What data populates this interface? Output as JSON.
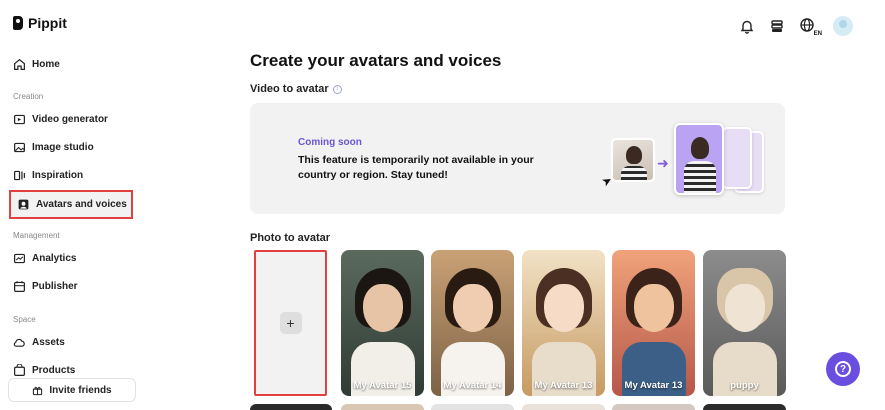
{
  "app": {
    "name": "Pippit"
  },
  "nav": {
    "home": "Home",
    "section_creation": "Creation",
    "video_generator": "Video generator",
    "image_studio": "Image studio",
    "inspiration": "Inspiration",
    "avatars_and_voices": "Avatars and voices",
    "section_management": "Management",
    "analytics": "Analytics",
    "publisher": "Publisher",
    "section_space": "Space",
    "assets": "Assets",
    "products": "Products",
    "invite_friends": "Invite friends"
  },
  "header": {
    "language_code": "EN"
  },
  "main": {
    "title": "Create your avatars and voices",
    "video_to_avatar": {
      "heading": "Video to avatar",
      "banner_status": "Coming soon",
      "banner_message": "This feature is temporarily not available in your country or region. Stay tuned!"
    },
    "photo_to_avatar": {
      "heading": "Photo to avatar",
      "upload_symbol": "+",
      "avatars": [
        {
          "label": "My Avatar 15"
        },
        {
          "label": "My Avatar 14"
        },
        {
          "label": "My Avatar 13"
        },
        {
          "label": "My Avatar 13"
        },
        {
          "label": "puppy"
        }
      ]
    }
  },
  "help": {
    "symbol": "?"
  },
  "colors": {
    "accent": "#6a4ee0",
    "highlight_border": "#e04040",
    "coming_soon": "#6a56d9"
  }
}
